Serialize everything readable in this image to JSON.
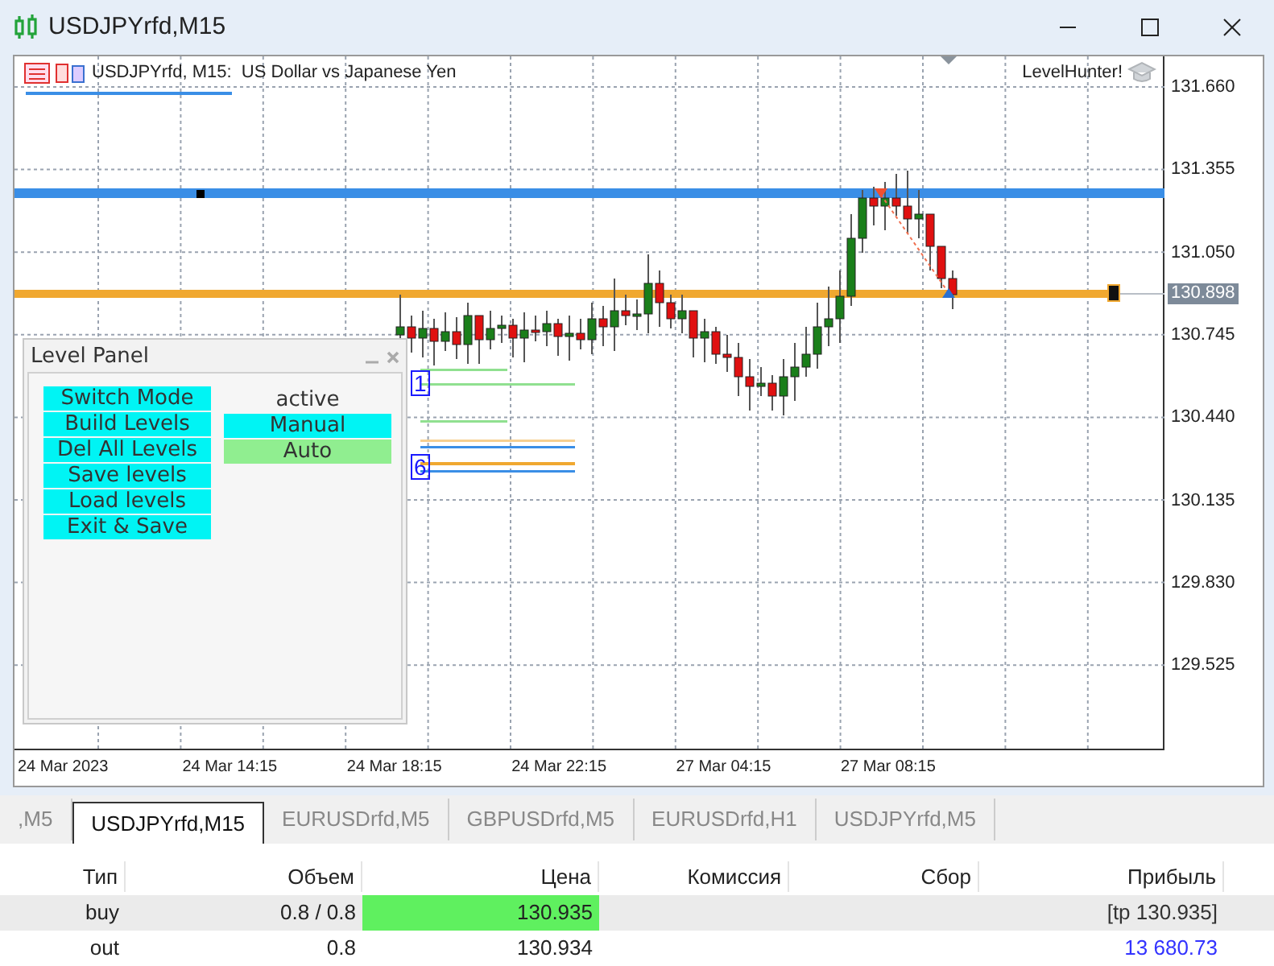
{
  "window": {
    "title": "USDJPYrfd,M15"
  },
  "chart": {
    "header": "USDJPYrfd, M15:  US Dollar vs Japanese Yen",
    "indicator": "LevelHunter!",
    "price_labels": [
      "131.660",
      "131.355",
      "131.050",
      "130.745",
      "130.440",
      "130.135",
      "129.830",
      "129.525"
    ],
    "current_price": "130.898",
    "time_labels": [
      "24 Mar 2023",
      "24 Mar 14:15",
      "24 Mar 18:15",
      "24 Mar 22:15",
      "27 Mar 04:15",
      "27 Mar 08:15"
    ],
    "level_markers": [
      "1",
      "6"
    ]
  },
  "level_panel": {
    "title": "Level Panel",
    "buttons": [
      "Switch Mode",
      "Build Levels",
      "Del All Levels",
      "Save levels",
      "Load levels",
      "Exit & Save"
    ],
    "mode_label": "active",
    "modes": [
      {
        "label": "Manual",
        "selected": false
      },
      {
        "label": "Auto",
        "selected": true
      }
    ]
  },
  "tabs": [
    {
      "label": ",M5",
      "selected": false
    },
    {
      "label": "USDJPYrfd,M15",
      "selected": true
    },
    {
      "label": "EURUSDrfd,M5",
      "selected": false
    },
    {
      "label": "GBPUSDrfd,M5",
      "selected": false
    },
    {
      "label": "EURUSDrfd,H1",
      "selected": false
    },
    {
      "label": "USDJPYrfd,M5",
      "selected": false
    }
  ],
  "table": {
    "columns": [
      "Тип",
      "Объем",
      "Цена",
      "Комиссия",
      "Сбор",
      "Прибыль"
    ],
    "rows": [
      {
        "selected": true,
        "type": "buy",
        "volume": "0.8 / 0.8",
        "price": "130.935",
        "profit": "[tp 130.935]",
        "color": "#333333"
      },
      {
        "selected": false,
        "type": "out",
        "volume": "0.8",
        "price": "130.934",
        "profit": "13 680.73",
        "color": "#3333ff"
      }
    ]
  }
}
